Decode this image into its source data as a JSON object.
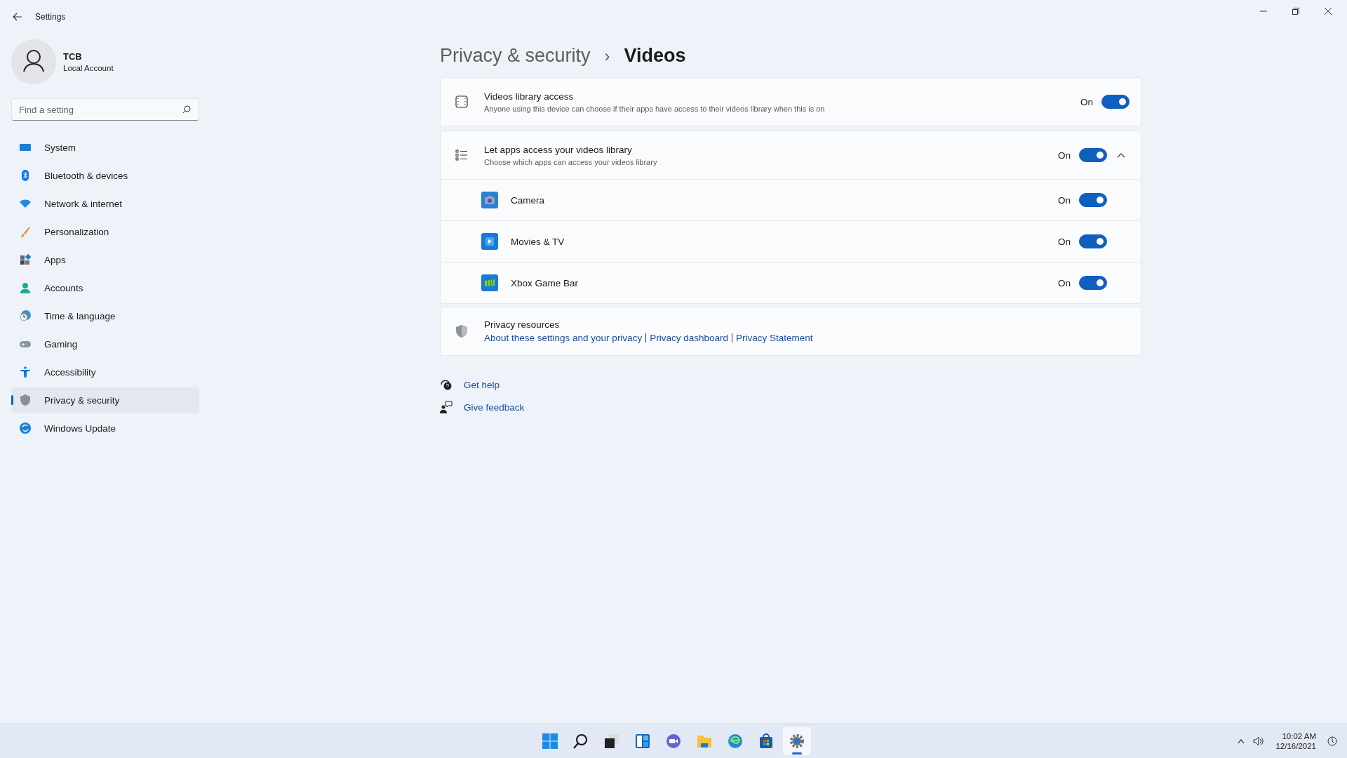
{
  "window": {
    "title": "Settings"
  },
  "account": {
    "name": "TCB",
    "type": "Local Account"
  },
  "search": {
    "placeholder": "Find a setting"
  },
  "sidebar": {
    "items": [
      {
        "label": "System",
        "selected": false
      },
      {
        "label": "Bluetooth & devices",
        "selected": false
      },
      {
        "label": "Network & internet",
        "selected": false
      },
      {
        "label": "Personalization",
        "selected": false
      },
      {
        "label": "Apps",
        "selected": false
      },
      {
        "label": "Accounts",
        "selected": false
      },
      {
        "label": "Time & language",
        "selected": false
      },
      {
        "label": "Gaming",
        "selected": false
      },
      {
        "label": "Accessibility",
        "selected": false
      },
      {
        "label": "Privacy & security",
        "selected": true
      },
      {
        "label": "Windows Update",
        "selected": false
      }
    ]
  },
  "breadcrumb": {
    "parent": "Privacy & security",
    "separator": "›",
    "current": "Videos"
  },
  "library_access": {
    "title": "Videos library access",
    "description": "Anyone using this device can choose if their apps have access to their videos library when this is on",
    "state_label": "On",
    "on": true
  },
  "app_access": {
    "title": "Let apps access your videos library",
    "description": "Choose which apps can access your videos library",
    "state_label": "On",
    "on": true,
    "expanded": true,
    "apps": [
      {
        "name": "Camera",
        "state_label": "On",
        "on": true
      },
      {
        "name": "Movies & TV",
        "state_label": "On",
        "on": true
      },
      {
        "name": "Xbox Game Bar",
        "state_label": "On",
        "on": true
      }
    ]
  },
  "privacy_resources": {
    "title": "Privacy resources",
    "links": [
      "About these settings and your privacy",
      "Privacy dashboard",
      "Privacy Statement"
    ]
  },
  "help_links": [
    "Get help",
    "Give feedback"
  ],
  "taskbar": {
    "items": [
      {
        "selected": false
      },
      {
        "selected": false
      },
      {
        "selected": false
      },
      {
        "selected": false
      },
      {
        "selected": false
      },
      {
        "selected": false
      },
      {
        "selected": false
      },
      {
        "selected": false
      },
      {
        "selected": true
      }
    ],
    "time": "10:02 AM",
    "date": "12/16/2021"
  }
}
